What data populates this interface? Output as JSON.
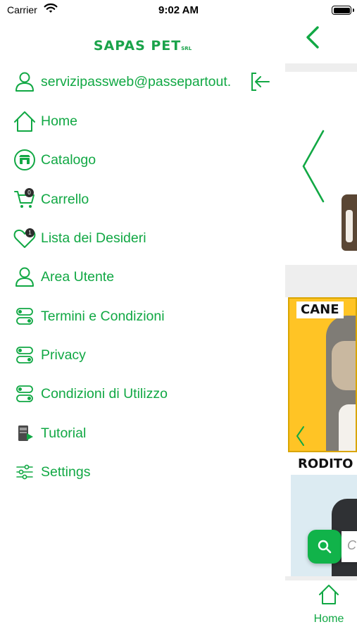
{
  "status_bar": {
    "carrier": "Carrier",
    "time": "9:02 AM"
  },
  "brand": {
    "name": "SAPAS PET",
    "suffix": "SRL"
  },
  "drawer": {
    "account_email": "servizipassweb@passepartout.",
    "items": [
      {
        "label": "Home",
        "icon": "home-icon"
      },
      {
        "label": "Catalogo",
        "icon": "shop-icon"
      },
      {
        "label": "Carrello",
        "icon": "cart-icon",
        "badge": "0"
      },
      {
        "label": "Lista dei Desideri",
        "icon": "heart-icon",
        "badge": "1"
      },
      {
        "label": "Area Utente",
        "icon": "user-icon"
      },
      {
        "label": "Termini e Condizioni",
        "icon": "toggle-icon"
      },
      {
        "label": "Privacy",
        "icon": "toggle-icon"
      },
      {
        "label": "Condizioni di Utilizzo",
        "icon": "toggle-icon"
      },
      {
        "label": "Tutorial",
        "icon": "tutorial-icon"
      },
      {
        "label": "Settings",
        "icon": "sliders-icon"
      }
    ]
  },
  "main": {
    "categories": [
      {
        "label": "CANE"
      },
      {
        "label": "RODITO"
      }
    ],
    "search": {
      "placeholder": "C"
    },
    "tabbar": {
      "home_label": "Home"
    }
  },
  "colors": {
    "accent": "#11a844",
    "badge": "#2d2d2d",
    "card_yellow": "#ffc425"
  }
}
